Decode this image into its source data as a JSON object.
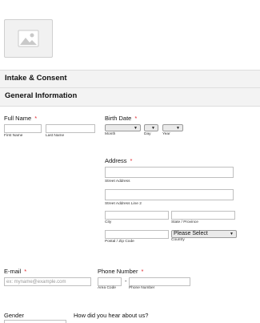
{
  "form": {
    "title": "Intake & Consent",
    "section_title": "General Information"
  },
  "full_name": {
    "label": "Full Name",
    "required_mark": "*",
    "first_sub": "First Name",
    "last_sub": "Last Name"
  },
  "birth_date": {
    "label": "Birth Date",
    "required_mark": "*",
    "month_sub": "Month",
    "day_sub": "Day",
    "year_sub": "Year"
  },
  "address": {
    "label": "Address",
    "required_mark": "*",
    "street_sub": "Street Address",
    "street2_sub": "Street Address Line 2",
    "city_sub": "City",
    "state_sub": "State / Province",
    "postal_sub": "Postal / Zip Code",
    "country_sub": "Country",
    "country_value": "Please Select"
  },
  "email": {
    "label": "E-mail",
    "required_mark": "*",
    "placeholder": "ex: myname@example.com"
  },
  "phone": {
    "label": "Phone Number",
    "required_mark": "*",
    "separator": "-",
    "area_sub": "Area Code",
    "number_sub": "Phone Number"
  },
  "gender": {
    "label": "Gender"
  },
  "hear_about": {
    "label": "How did you hear about us?"
  },
  "icons": {
    "logo": "image-placeholder-icon",
    "dropdown": "caret-down-icon"
  }
}
